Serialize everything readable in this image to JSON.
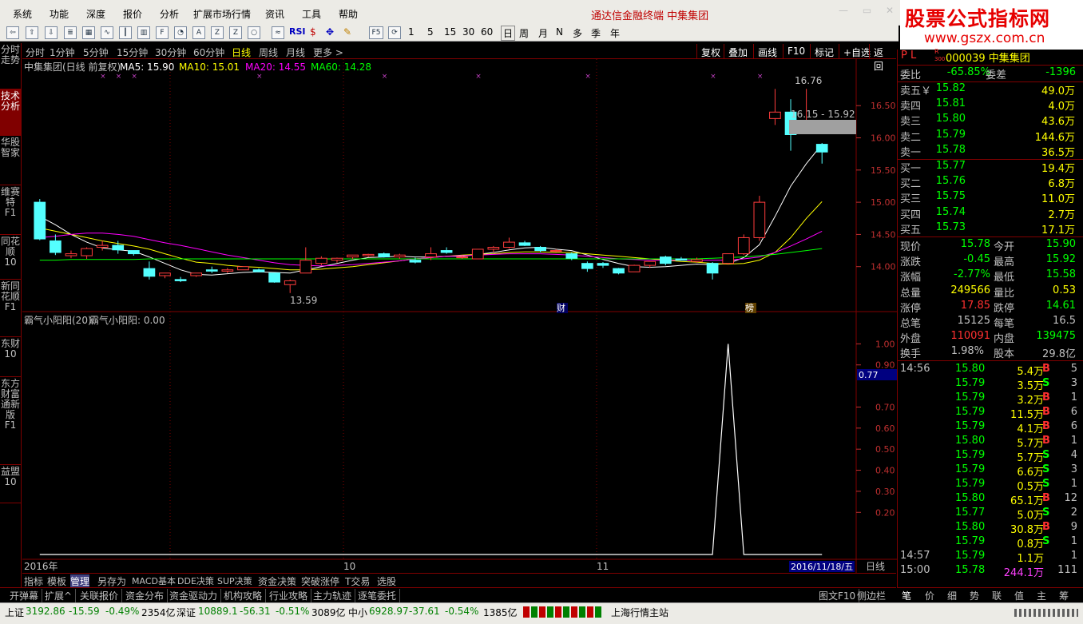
{
  "menu": [
    "系统",
    "功能",
    "深度",
    "报价",
    "分析",
    "扩展市场行情",
    "资讯",
    "工具",
    "帮助"
  ],
  "title": "通达信金融终端  中集集团",
  "window_buttons": [
    "—",
    "▭",
    "✕"
  ],
  "toolbar": {
    "rsi": "RSI",
    "f5": "F5",
    "nums": [
      "1",
      "5",
      "15",
      "30",
      "60"
    ],
    "periods": [
      "日",
      "周",
      "月",
      "N",
      "多",
      "季",
      "年"
    ]
  },
  "logo": {
    "line1": "股票公式指标网",
    "line2": "www.gszx.com.cn"
  },
  "left_tabs": [
    "分时走势",
    "技术分析",
    "华股智家",
    "维赛特F1",
    "同花顺10",
    "新同花顺F1",
    "东财10",
    "东方财富通新版F1",
    "益盟10"
  ],
  "periods": [
    "分时",
    "1分钟",
    "5分钟",
    "15分钟",
    "30分钟",
    "60分钟",
    "日线",
    "周线",
    "月线",
    "更多 >"
  ],
  "period_right": [
    "复权",
    "叠加",
    "画线",
    "F10",
    "标记",
    "+自选",
    "返回"
  ],
  "chart": {
    "title": "中集集团(日线 前复权)",
    "ma": [
      {
        "label": "MA5: 15.90",
        "color": "#ffffff"
      },
      {
        "label": "MA10: 15.01",
        "color": "#ffff00"
      },
      {
        "label": "MA20: 14.55",
        "color": "#ff00ff"
      },
      {
        "label": "MA60: 14.28",
        "color": "#00ff00"
      }
    ],
    "price_ticks": [
      "16.50",
      "16.00",
      "15.50",
      "15.00",
      "14.50",
      "14.00"
    ],
    "ann_high": "16.76",
    "ann_range": "16.15 - 15.92",
    "ann_low": "13.59",
    "tag_cai": "财",
    "tag_bang": "榜",
    "ind_title": "霸气小阳阳(20)",
    "ind_value": "霸气小阳阳: 0.00",
    "ind_ticks": [
      "1.00",
      "0.90",
      "0.70",
      "0.60",
      "0.50",
      "0.40",
      "0.30",
      "0.20"
    ],
    "ind_current": "0.77",
    "x_labels": [
      "2016年",
      "10",
      "11"
    ],
    "date": "2016/11/18/五",
    "period": "日线",
    "zoom_btns": [
      "+",
      "-",
      "0"
    ]
  },
  "chart_data": {
    "type": "candlestick",
    "title": "中集集团(日线 前复权)",
    "ylim": [
      13.5,
      16.9
    ],
    "candles": [
      {
        "o": 15.0,
        "h": 15.05,
        "l": 14.41,
        "c": 14.43
      },
      {
        "o": 14.4,
        "h": 14.5,
        "l": 14.18,
        "c": 14.22
      },
      {
        "o": 14.17,
        "h": 14.25,
        "l": 14.13,
        "c": 14.2
      },
      {
        "o": 14.17,
        "h": 14.3,
        "l": 14.12,
        "c": 14.28
      },
      {
        "o": 14.3,
        "h": 14.4,
        "l": 14.25,
        "c": 14.33
      },
      {
        "o": 14.33,
        "h": 14.4,
        "l": 14.2,
        "c": 14.26
      },
      {
        "o": 14.25,
        "h": 14.25,
        "l": 14.17,
        "c": 14.2
      },
      {
        "o": 13.97,
        "h": 14.08,
        "l": 13.8,
        "c": 13.85
      },
      {
        "o": 13.86,
        "h": 13.88,
        "l": 13.82,
        "c": 13.9
      },
      {
        "o": 13.8,
        "h": 13.84,
        "l": 13.76,
        "c": 13.78
      },
      {
        "o": 13.86,
        "h": 13.9,
        "l": 13.84,
        "c": 13.9
      },
      {
        "o": 13.95,
        "h": 14.0,
        "l": 13.9,
        "c": 13.93
      },
      {
        "o": 13.93,
        "h": 13.98,
        "l": 13.9,
        "c": 13.95
      },
      {
        "o": 13.95,
        "h": 14.0,
        "l": 13.95,
        "c": 14.0
      },
      {
        "o": 13.95,
        "h": 13.97,
        "l": 13.92,
        "c": 13.92
      },
      {
        "o": 13.9,
        "h": 13.9,
        "l": 13.75,
        "c": 13.76
      },
      {
        "o": 13.72,
        "h": 13.8,
        "l": 13.59,
        "c": 13.78
      },
      {
        "o": 13.9,
        "h": 14.3,
        "l": 13.9,
        "c": 14.1
      },
      {
        "o": 14.05,
        "h": 14.16,
        "l": 14.02,
        "c": 14.13
      },
      {
        "o": 14.1,
        "h": 14.14,
        "l": 14.06,
        "c": 14.13
      },
      {
        "o": 14.15,
        "h": 14.18,
        "l": 14.12,
        "c": 14.18
      },
      {
        "o": 14.17,
        "h": 14.2,
        "l": 14.15,
        "c": 14.19
      },
      {
        "o": 14.2,
        "h": 14.22,
        "l": 14.14,
        "c": 14.15
      },
      {
        "o": 14.15,
        "h": 14.2,
        "l": 14.12,
        "c": 14.18
      },
      {
        "o": 14.1,
        "h": 14.14,
        "l": 14.05,
        "c": 14.07
      },
      {
        "o": 14.15,
        "h": 14.3,
        "l": 14.1,
        "c": 14.2
      },
      {
        "o": 14.25,
        "h": 14.3,
        "l": 14.2,
        "c": 14.22
      },
      {
        "o": 14.15,
        "h": 14.17,
        "l": 14.12,
        "c": 14.15
      },
      {
        "o": 14.12,
        "h": 14.27,
        "l": 14.12,
        "c": 14.27
      },
      {
        "o": 14.27,
        "h": 14.32,
        "l": 14.22,
        "c": 14.3
      },
      {
        "o": 14.3,
        "h": 14.45,
        "l": 14.28,
        "c": 14.38
      },
      {
        "o": 14.37,
        "h": 14.4,
        "l": 14.32,
        "c": 14.33
      },
      {
        "o": 14.3,
        "h": 14.32,
        "l": 14.22,
        "c": 14.25
      },
      {
        "o": 14.25,
        "h": 14.27,
        "l": 14.23,
        "c": 14.25
      },
      {
        "o": 14.2,
        "h": 14.22,
        "l": 14.1,
        "c": 14.13
      },
      {
        "o": 14.05,
        "h": 14.08,
        "l": 13.92,
        "c": 13.97
      },
      {
        "o": 14.05,
        "h": 14.07,
        "l": 13.98,
        "c": 14.02
      },
      {
        "o": 13.97,
        "h": 13.98,
        "l": 13.88,
        "c": 13.9
      },
      {
        "o": 13.92,
        "h": 14.03,
        "l": 13.92,
        "c": 14.02
      },
      {
        "o": 14.02,
        "h": 14.08,
        "l": 13.98,
        "c": 14.08
      },
      {
        "o": 14.15,
        "h": 14.17,
        "l": 14.02,
        "c": 14.05
      },
      {
        "o": 14.12,
        "h": 14.15,
        "l": 14.1,
        "c": 14.1
      },
      {
        "o": 14.08,
        "h": 14.14,
        "l": 14.06,
        "c": 14.11
      },
      {
        "o": 14.05,
        "h": 14.07,
        "l": 13.8,
        "c": 13.9
      },
      {
        "o": 14.05,
        "h": 14.2,
        "l": 14.03,
        "c": 14.2
      },
      {
        "o": 14.2,
        "h": 14.5,
        "l": 14.18,
        "c": 14.45
      },
      {
        "o": 14.45,
        "h": 15.1,
        "l": 14.4,
        "c": 15.0
      },
      {
        "o": 16.3,
        "h": 16.76,
        "l": 16.2,
        "c": 16.4
      },
      {
        "o": 16.4,
        "h": 16.6,
        "l": 15.8,
        "c": 16.05
      },
      {
        "o": 16.15,
        "h": 16.76,
        "l": 16.15,
        "c": 16.2
      },
      {
        "o": 15.9,
        "h": 15.92,
        "l": 15.6,
        "c": 15.78
      }
    ],
    "series": [
      {
        "name": "MA5",
        "color": "#ffffff",
        "values": [
          14.78,
          14.65,
          14.5,
          14.38,
          14.29,
          14.26,
          14.24,
          14.15,
          14.05,
          13.95,
          13.88,
          13.87,
          13.89,
          13.91,
          13.92,
          13.91,
          13.9,
          13.95,
          14.0,
          14.05,
          14.1,
          14.14,
          14.15,
          14.16,
          14.15,
          14.15,
          14.16,
          14.16,
          14.19,
          14.22,
          14.26,
          14.29,
          14.3,
          14.27,
          14.25,
          14.18,
          14.11,
          14.05,
          14.0,
          13.99,
          14.0,
          14.02,
          14.04,
          14.03,
          14.05,
          14.14,
          14.34,
          14.78,
          15.25,
          15.6,
          15.9
        ]
      },
      {
        "name": "MA10",
        "color": "#ffff00",
        "values": [
          14.6,
          14.55,
          14.5,
          14.45,
          14.4,
          14.36,
          14.32,
          14.27,
          14.2,
          14.13,
          14.07,
          14.05,
          14.02,
          14.0,
          13.99,
          13.97,
          13.95,
          13.95,
          13.96,
          13.98,
          14.0,
          14.03,
          14.06,
          14.09,
          14.12,
          14.14,
          14.16,
          14.18,
          14.19,
          14.2,
          14.22,
          14.23,
          14.23,
          14.22,
          14.22,
          14.2,
          14.18,
          14.16,
          14.14,
          14.12,
          14.1,
          14.08,
          14.07,
          14.05,
          14.04,
          14.05,
          14.1,
          14.22,
          14.45,
          14.75,
          15.01
        ]
      },
      {
        "name": "MA20",
        "color": "#ff00ff",
        "values": [
          14.45,
          14.47,
          14.5,
          14.52,
          14.52,
          14.5,
          14.47,
          14.42,
          14.37,
          14.33,
          14.28,
          14.23,
          14.18,
          14.14,
          14.1,
          14.06,
          14.03,
          14.02,
          14.01,
          14.02,
          14.03,
          14.05,
          14.07,
          14.09,
          14.12,
          14.14,
          14.16,
          14.17,
          14.18,
          14.19,
          14.2,
          14.2,
          14.2,
          14.19,
          14.18,
          14.16,
          14.14,
          14.12,
          14.11,
          14.1,
          14.1,
          14.1,
          14.1,
          14.1,
          14.1,
          14.12,
          14.15,
          14.22,
          14.32,
          14.43,
          14.55
        ]
      },
      {
        "name": "MA60",
        "color": "#00ff00",
        "values": [
          14.1,
          14.1,
          14.11,
          14.11,
          14.11,
          14.11,
          14.11,
          14.12,
          14.12,
          14.12,
          14.12,
          14.12,
          14.12,
          14.12,
          14.12,
          14.12,
          14.12,
          14.12,
          14.12,
          14.12,
          14.12,
          14.12,
          14.12,
          14.12,
          14.12,
          14.12,
          14.12,
          14.12,
          14.12,
          14.12,
          14.12,
          14.12,
          14.12,
          14.12,
          14.12,
          14.12,
          14.12,
          14.12,
          14.12,
          14.12,
          14.12,
          14.12,
          14.12,
          14.13,
          14.14,
          14.15,
          14.17,
          14.19,
          14.22,
          14.25,
          14.28
        ]
      }
    ],
    "indicator": {
      "name": "霸气小阳阳",
      "ylim": [
        0,
        1.1
      ],
      "values": [
        0,
        0,
        0,
        0,
        0,
        0,
        0,
        0,
        0,
        0,
        0,
        0,
        0,
        0,
        0,
        0,
        0,
        0,
        0,
        0,
        0,
        0,
        0,
        0,
        0,
        0,
        0,
        0,
        0,
        0,
        0,
        0,
        0,
        0,
        0,
        0,
        0,
        0,
        0,
        0,
        0,
        0,
        0,
        0,
        1.0,
        0,
        0,
        0,
        0,
        0,
        0
      ]
    }
  },
  "quote": {
    "header_pl": "P L",
    "header_r": "R",
    "header_n": "300",
    "code_name": "000039 中集集团",
    "weibi_l": "委比",
    "weibi_v": "-65.85%",
    "weicha_l": "委差",
    "weicha_v": "-1396",
    "asks": [
      {
        "l": "卖五￥",
        "p": "15.82",
        "v": "49.0万"
      },
      {
        "l": "卖四",
        "p": "15.81",
        "v": "4.0万"
      },
      {
        "l": "卖三",
        "p": "15.80",
        "v": "43.6万"
      },
      {
        "l": "卖二",
        "p": "15.79",
        "v": "144.6万"
      },
      {
        "l": "卖一",
        "p": "15.78",
        "v": "36.5万"
      }
    ],
    "bids": [
      {
        "l": "买一",
        "p": "15.77",
        "v": "19.4万"
      },
      {
        "l": "买二",
        "p": "15.76",
        "v": "6.8万"
      },
      {
        "l": "买三",
        "p": "15.75",
        "v": "11.0万"
      },
      {
        "l": "买四",
        "p": "15.74",
        "v": "2.7万"
      },
      {
        "l": "买五",
        "p": "15.73",
        "v": "17.1万"
      }
    ],
    "stats": [
      {
        "l1": "现价",
        "v1": "15.78",
        "c1": "#00ff00",
        "l2": "今开",
        "v2": "15.90",
        "c2": "#00ff00"
      },
      {
        "l1": "涨跌",
        "v1": "-0.45",
        "c1": "#00ff00",
        "l2": "最高",
        "v2": "15.92",
        "c2": "#00ff00"
      },
      {
        "l1": "涨幅",
        "v1": "-2.77%",
        "c1": "#00ff00",
        "l2": "最低",
        "v2": "15.58",
        "c2": "#00ff00"
      },
      {
        "l1": "总量",
        "v1": "249566",
        "c1": "#ffff00",
        "l2": "量比",
        "v2": "0.53",
        "c2": "#ffff00"
      },
      {
        "l1": "涨停",
        "v1": "17.85",
        "c1": "#ff3030",
        "l2": "跌停",
        "v2": "14.61",
        "c2": "#00ff00"
      },
      {
        "l1": "总笔",
        "v1": "15125",
        "c1": "#c0c0c0",
        "l2": "每笔",
        "v2": "16.5",
        "c2": "#c0c0c0"
      },
      {
        "l1": "外盘",
        "v1": "110091",
        "c1": "#ff3030",
        "l2": "内盘",
        "v2": "139475",
        "c2": "#00ff00"
      },
      {
        "l1": "换手",
        "v1": "1.98%",
        "c1": "#c0c0c0",
        "l2": "股本",
        "v2": "29.8亿",
        "c2": "#c0c0c0"
      }
    ],
    "ticks": [
      {
        "t": "14:56",
        "p": "15.80",
        "v": "5.4万",
        "f": "B",
        "n": "5"
      },
      {
        "t": "",
        "p": "15.79",
        "v": "3.5万",
        "f": "S",
        "n": "3"
      },
      {
        "t": "",
        "p": "15.79",
        "v": "3.2万",
        "f": "B",
        "n": "1"
      },
      {
        "t": "",
        "p": "15.79",
        "v": "11.5万",
        "f": "B",
        "n": "6"
      },
      {
        "t": "",
        "p": "15.79",
        "v": "4.1万",
        "f": "B",
        "n": "6"
      },
      {
        "t": "",
        "p": "15.80",
        "v": "5.7万",
        "f": "B",
        "n": "1"
      },
      {
        "t": "",
        "p": "15.79",
        "v": "5.7万",
        "f": "S",
        "n": "4"
      },
      {
        "t": "",
        "p": "15.79",
        "v": "6.6万",
        "f": "S",
        "n": "3"
      },
      {
        "t": "",
        "p": "15.79",
        "v": "0.5万",
        "f": "S",
        "n": "1"
      },
      {
        "t": "",
        "p": "15.80",
        "v": "65.1万",
        "f": "B",
        "n": "12"
      },
      {
        "t": "",
        "p": "15.77",
        "v": "5.0万",
        "f": "S",
        "n": "2"
      },
      {
        "t": "",
        "p": "15.80",
        "v": "30.8万",
        "f": "B",
        "n": "9"
      },
      {
        "t": "",
        "p": "15.79",
        "v": "0.8万",
        "f": "S",
        "n": "1"
      },
      {
        "t": "14:57",
        "p": "15.79",
        "v": "1.1万",
        "f": "",
        "n": "1"
      },
      {
        "t": "15:00",
        "p": "15.78",
        "v": "244.1万",
        "f": "",
        "n": "111"
      }
    ],
    "tabs": [
      "笔",
      "价",
      "细",
      "势",
      "联",
      "值",
      "主",
      "筹"
    ]
  },
  "bottom_tabs": [
    "指标",
    "模板",
    "管理",
    "另存为",
    "MACD基本",
    "DDE决策",
    "SUP决策",
    "资金决策",
    "突破涨停",
    "T交易",
    "选股"
  ],
  "func_bar": [
    "开弹幕",
    "扩展^",
    "关联报价",
    "资金分布",
    "资金驱动力",
    "机构攻略",
    "行业攻略",
    "主力轨迹",
    "逐笔委托"
  ],
  "func_right": [
    "图文F10",
    "侧边栏<"
  ],
  "status": {
    "sh_l": "上证",
    "sh_v": "3192.86",
    "sh_c": "-15.59",
    "sh_p": "-0.49%",
    "sh_a": "2354亿",
    "sz_l": "深证",
    "sz_v": "10889.1",
    "sz_c": "-56.31",
    "sz_p": "-0.51%",
    "sz_a": "3089亿",
    "zx_l": "中小",
    "zx_v": "6928.97",
    "zx_c": "-37.61",
    "zx_p": "-0.54%",
    "zx_a": "1385亿",
    "site": "上海行情主站"
  }
}
